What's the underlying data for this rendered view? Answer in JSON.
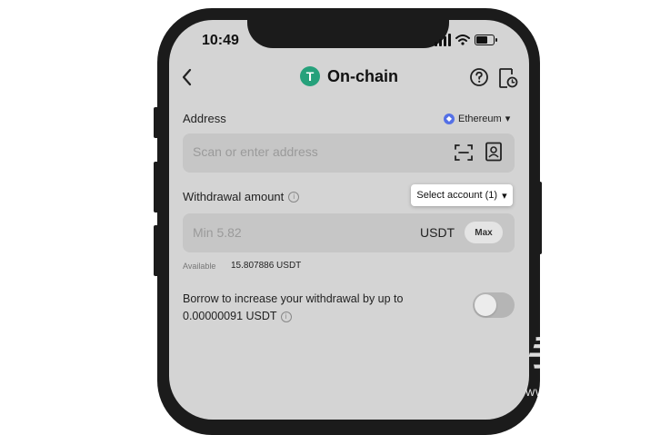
{
  "status_bar": {
    "time": "10:49"
  },
  "header": {
    "title": "On-chain",
    "token_symbol": "T",
    "token_color": "#26a17b"
  },
  "address": {
    "label": "Address",
    "network": "Ethereum",
    "placeholder": "Scan or enter address"
  },
  "withdrawal": {
    "label": "Withdrawal amount",
    "select_account": "Select account (1)",
    "placeholder": "Min 5.82",
    "unit": "USDT",
    "max_label": "Max",
    "available_label": "Available",
    "available_value": "15.807886 USDT"
  },
  "borrow": {
    "text": "Borrow to increase your withdrawal by up to 0.00000091 USDT",
    "enabled": false
  },
  "watermark": {
    "brand": "手游TV",
    "url": "WWW.SHOUYOUTV.COM"
  }
}
